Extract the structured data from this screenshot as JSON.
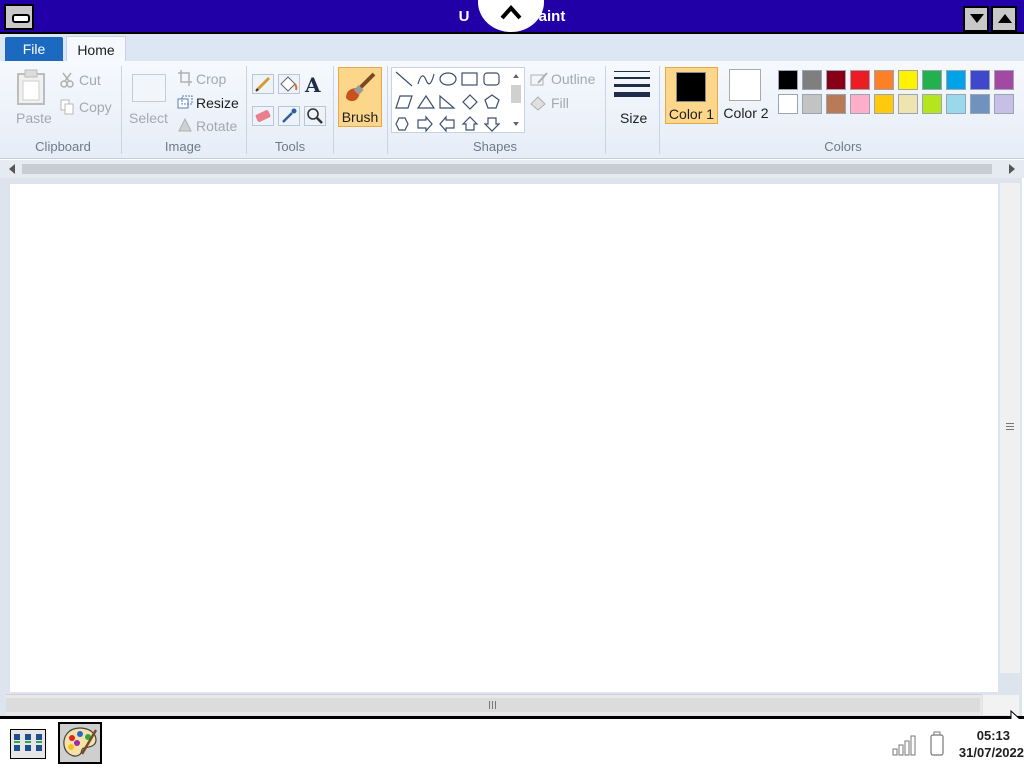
{
  "window": {
    "title": "Untitled - Paint",
    "visible_title_right": "- Paint",
    "visible_title_left": "U"
  },
  "tabs": {
    "file": "File",
    "home": "Home"
  },
  "clipboard": {
    "paste": "Paste",
    "cut": "Cut",
    "copy": "Copy",
    "group": "Clipboard"
  },
  "image": {
    "select": "Select",
    "crop": "Crop",
    "resize": "Resize",
    "rotate": "Rotate",
    "group": "Image"
  },
  "tools": {
    "group": "Tools"
  },
  "brush": {
    "label": "Brush"
  },
  "shapes": {
    "outline": "Outline",
    "fill": "Fill",
    "group": "Shapes"
  },
  "size": {
    "label": "Size"
  },
  "colors": {
    "color1": "Color 1",
    "color2": "Color 2",
    "group": "Colors",
    "color1_value": "#000000",
    "color2_value": "#ffffff",
    "palette_row1": [
      "#000000",
      "#7f7f7f",
      "#880015",
      "#ed1c24",
      "#ff7f27",
      "#fff200",
      "#22b14c",
      "#00a2e8",
      "#3f48cc",
      "#a349a4"
    ],
    "palette_row2": [
      "#ffffff",
      "#c3c3c3",
      "#b97a57",
      "#ffaec9",
      "#ffc90e",
      "#efe4b0",
      "#b5e61d",
      "#99d9ea",
      "#7092be",
      "#c8bfe7"
    ]
  },
  "taskbar": {
    "time": "05:13",
    "date": "31/07/2022"
  },
  "theme": {
    "titlebar": "#2200a8",
    "file_tab": "#1b6ac0",
    "brush_active": "#fcd68a"
  }
}
